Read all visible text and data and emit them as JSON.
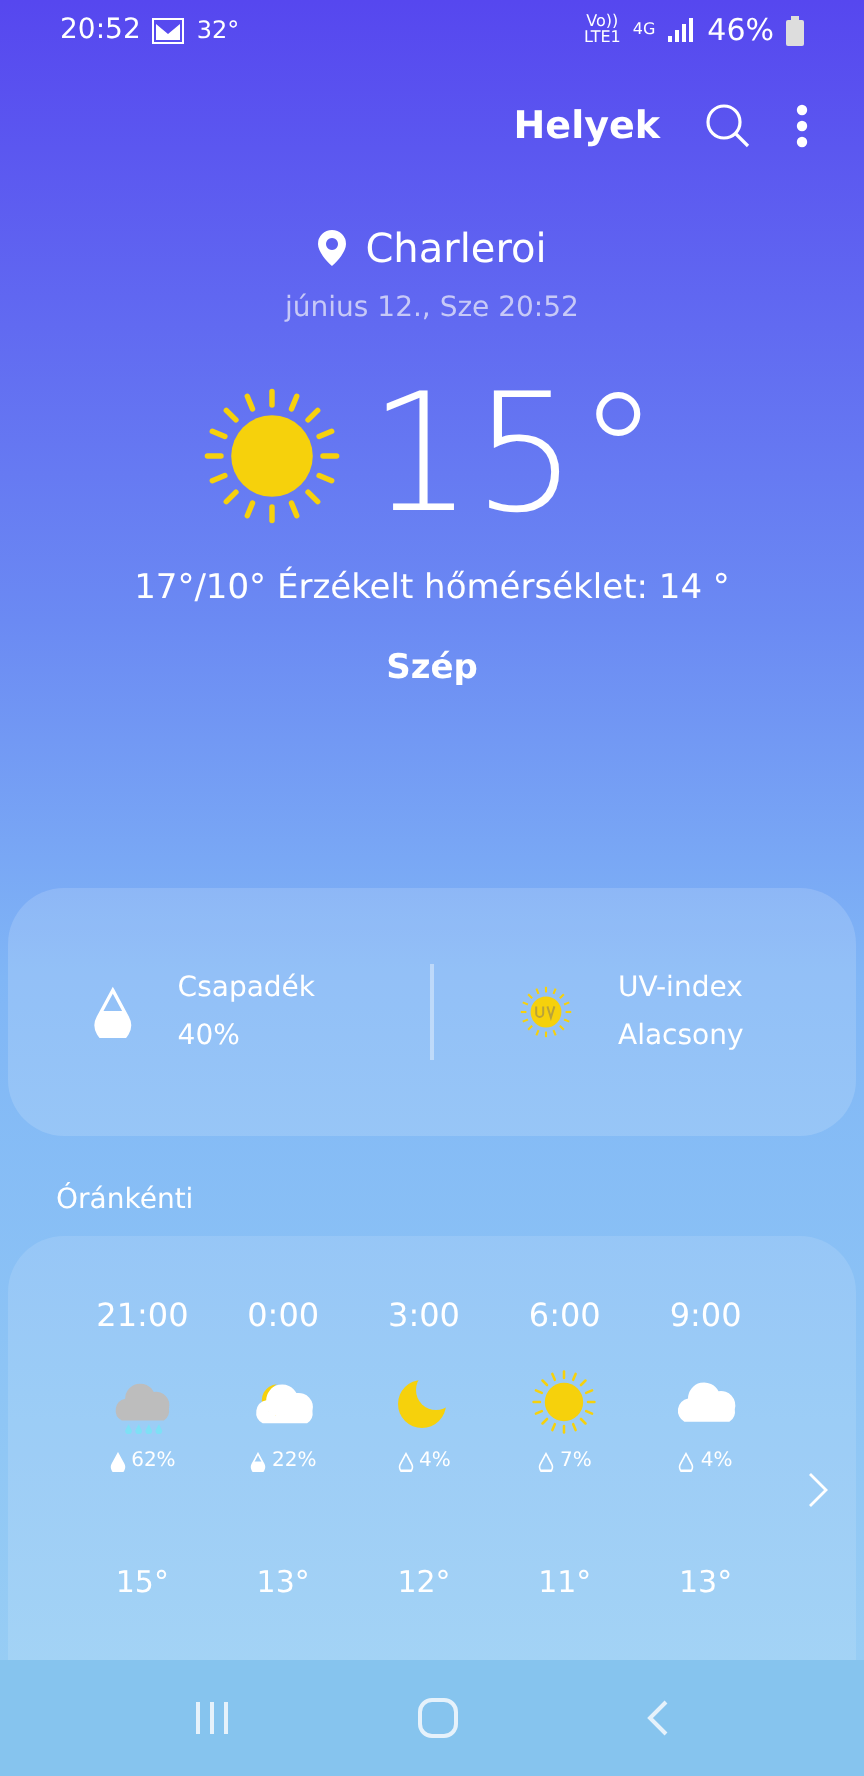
{
  "status_bar": {
    "time": "20:52",
    "temperature": "32°",
    "network": "4G",
    "carrier": "Vo))\nLTE1",
    "battery": "46%"
  },
  "header": {
    "places_label": "Helyek"
  },
  "location": {
    "city": "Charleroi",
    "date": "június 12., Sze 20:52"
  },
  "current": {
    "kind": "sun",
    "temperature": "15°",
    "details": "17°/10° Érzékelt hőmérséklet: 14 °",
    "condition": "Szép"
  },
  "summary": [
    {
      "kind": "precipitation",
      "label": "Csapadék",
      "value": "40%",
      "drop": {
        "kind": "half"
      }
    },
    {
      "kind": "uv",
      "label": "UV-index",
      "value": "Alacsony"
    }
  ],
  "hourly": {
    "title": "Óránkénti",
    "items": [
      {
        "time": "21:00",
        "kind": "rain",
        "precip": {
          "kind": "full",
          "text": "62%"
        },
        "temperature": "15°"
      },
      {
        "time": "0:00",
        "kind": "night-cloud",
        "precip": {
          "kind": "half",
          "text": "22%"
        },
        "temperature": "13°"
      },
      {
        "time": "3:00",
        "kind": "moon",
        "precip": {
          "kind": "empty",
          "text": "4%"
        },
        "temperature": "12°"
      },
      {
        "time": "6:00",
        "kind": "sun",
        "precip": {
          "kind": "empty",
          "text": "7%"
        },
        "temperature": "11°"
      },
      {
        "time": "9:00",
        "kind": "cloud",
        "precip": {
          "kind": "empty",
          "text": "4%"
        },
        "temperature": "13°"
      }
    ]
  }
}
